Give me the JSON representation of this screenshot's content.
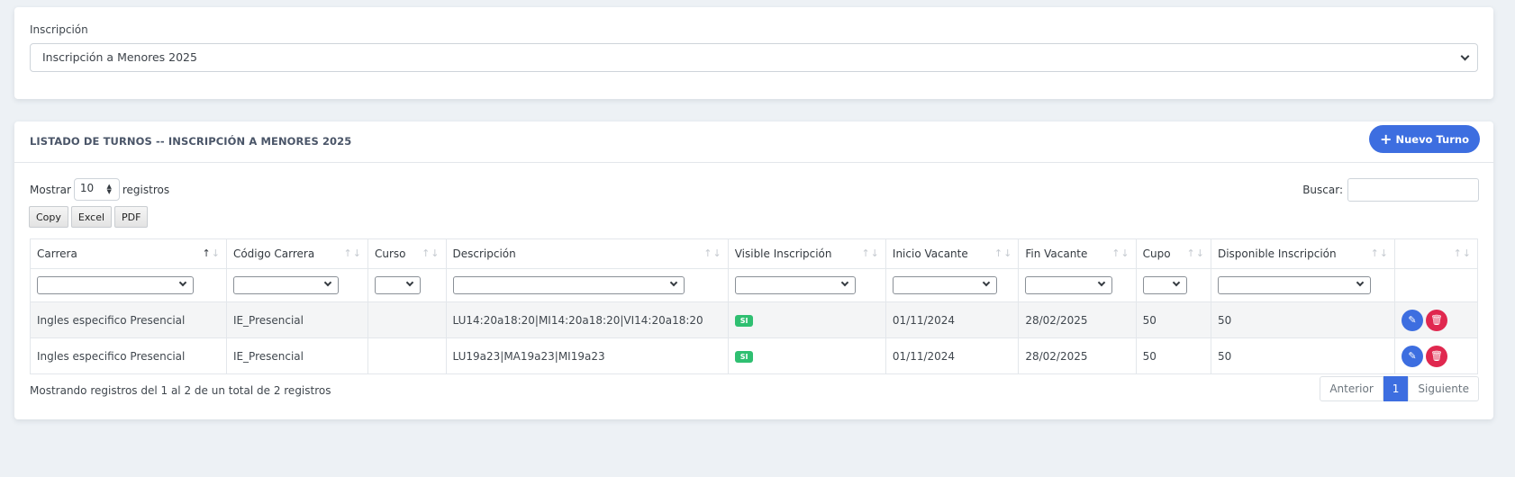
{
  "inscripcion": {
    "label": "Inscripción",
    "selected": "Inscripción a Menores 2025"
  },
  "listado": {
    "title": "LISTADO DE TURNOS -- INSCRIPCIÓN A MENORES 2025",
    "new_button": "Nuevo Turno",
    "show_prefix": "Mostrar",
    "show_value": "10",
    "show_suffix": "registros",
    "search_label": "Buscar:",
    "export_buttons": [
      "Copy",
      "Excel",
      "PDF"
    ],
    "columns": [
      "Carrera",
      "Código Carrera",
      "Curso",
      "Descripción",
      "Visible Inscripción",
      "Inicio Vacante",
      "Fin Vacante",
      "Cupo",
      "Disponible Inscripción",
      ""
    ],
    "rows": [
      [
        "Ingles especifico Presencial",
        "IE_Presencial",
        "",
        "LU14:20a18:20|MI14:20a18:20|VI14:20a18:20",
        "SI",
        "01/11/2024",
        "28/02/2025",
        "50",
        "50"
      ],
      [
        "Ingles especifico Presencial",
        "IE_Presencial",
        "",
        "LU19a23|MA19a23|MI19a23",
        "SI",
        "01/11/2024",
        "28/02/2025",
        "50",
        "50"
      ]
    ],
    "info": "Mostrando registros del 1 al 2 de un total de 2 registros",
    "pagination": {
      "prev": "Anterior",
      "current": "1",
      "next": "Siguiente"
    }
  },
  "colors": {
    "primary": "#3d6ee0",
    "danger": "#e0284f",
    "success": "#2fbf71",
    "background": "#edf1f5"
  }
}
